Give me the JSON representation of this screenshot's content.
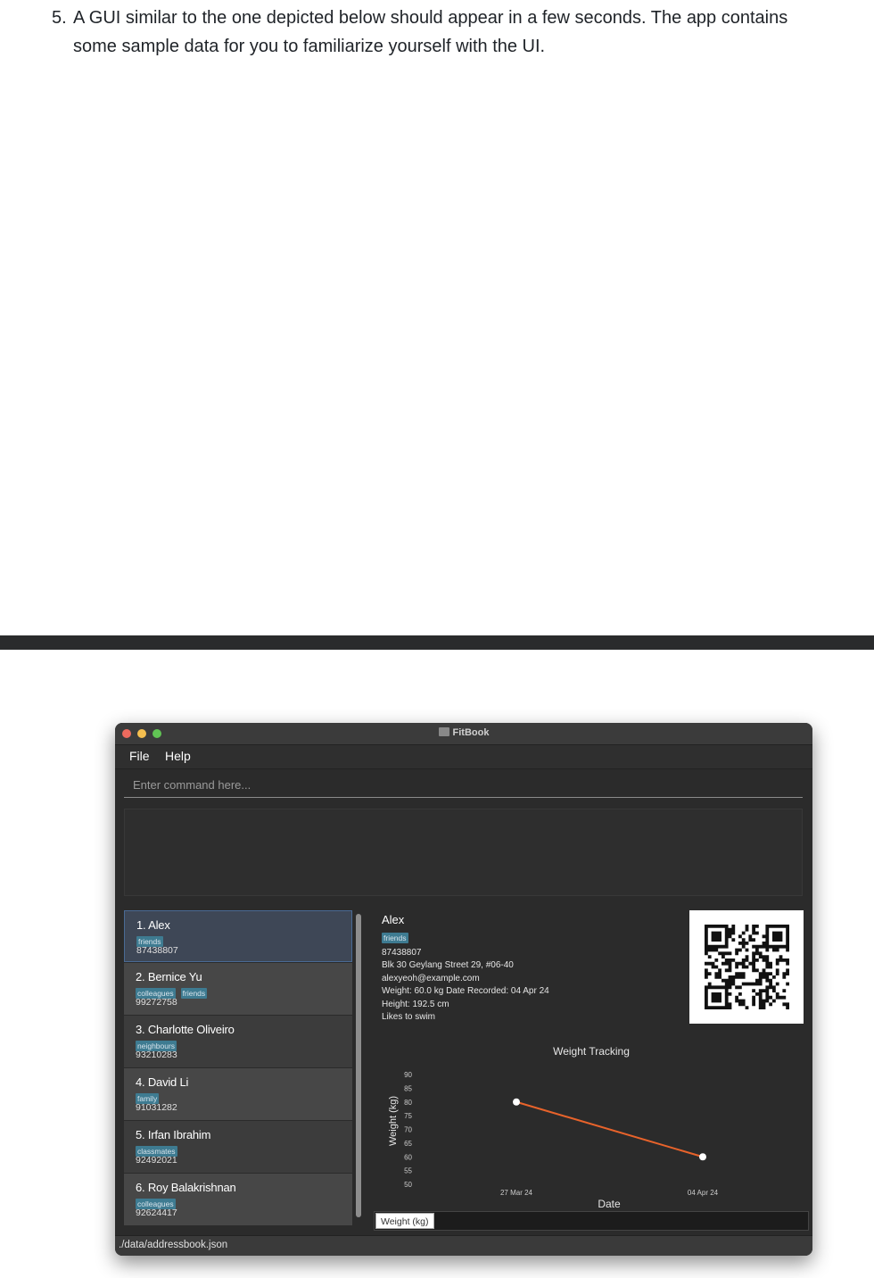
{
  "doc": {
    "step_number": "5.",
    "line1": "A GUI similar to the one depicted below should appear in a few seconds. The app contains",
    "line2": "some sample data for you to familiarize yourself with the UI."
  },
  "window": {
    "title": "FitBook"
  },
  "menu": {
    "file": "File",
    "help": "Help"
  },
  "command": {
    "placeholder": "Enter command here...",
    "value": ""
  },
  "result": {
    "text": ""
  },
  "persons": [
    {
      "name": "1. Alex",
      "tags": [
        "friends"
      ],
      "phone": "87438807"
    },
    {
      "name": "2. Bernice Yu",
      "tags": [
        "colleagues",
        "friends"
      ],
      "phone": "99272758"
    },
    {
      "name": "3. Charlotte Oliveiro",
      "tags": [
        "neighbours"
      ],
      "phone": "93210283"
    },
    {
      "name": "4. David Li",
      "tags": [
        "family"
      ],
      "phone": "91031282"
    },
    {
      "name": "5. Irfan Ibrahim",
      "tags": [
        "classmates"
      ],
      "phone": "92492021"
    },
    {
      "name": "6. Roy Balakrishnan",
      "tags": [
        "colleagues"
      ],
      "phone": "92624417"
    }
  ],
  "detail": {
    "name": "Alex",
    "tag": "friends",
    "phone": "87438807",
    "address": "Blk 30 Geylang Street 29, #06-40",
    "email": "alexyeoh@example.com",
    "weight_line": "Weight: 60.0 kg   Date Recorded: 04 Apr 24",
    "height_line": "Height: 192.5 cm",
    "note": "Likes to swim"
  },
  "chart_data": {
    "type": "line",
    "title": "Weight Tracking",
    "xlabel": "Date",
    "ylabel": "Weight (kg)",
    "x": [
      "27 Mar 24",
      "04 Apr 24"
    ],
    "values": [
      80,
      60
    ],
    "ylim": [
      50,
      90
    ],
    "yticks": [
      50,
      55,
      60,
      65,
      70,
      75,
      80,
      85,
      90
    ],
    "line_color": "#e8632b",
    "point_color": "#ffffff"
  },
  "chart_tab": {
    "label": "Weight (kg)"
  },
  "status": {
    "path": "./data/addressbook.json"
  }
}
